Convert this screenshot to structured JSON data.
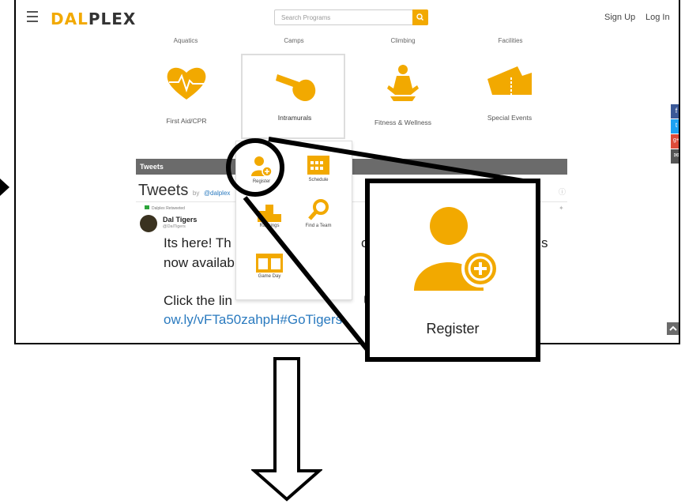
{
  "header": {
    "logo_part1": "DAL",
    "logo_part2": "PLEX",
    "search_placeholder": "Search Programs",
    "signup": "Sign Up",
    "login": "Log In"
  },
  "categories": [
    "Aquatics",
    "Camps",
    "Climbing",
    "Facilities"
  ],
  "tiles": [
    {
      "label": "First Aid/CPR"
    },
    {
      "label": "Intramurals"
    },
    {
      "label": "Fitness & Wellness"
    },
    {
      "label": "Special Events"
    }
  ],
  "dropdown": {
    "register": "Register",
    "schedule": "Schedule",
    "rankings": "Rankings",
    "find_team": "Find a Team",
    "game_day": "Game Day"
  },
  "tweets": {
    "bar_title": "Tweets",
    "heading": "Tweets",
    "by": "by",
    "handle": "@dalplex",
    "retweeted": "Dalplex Retweeted",
    "author": "Dal Tigers",
    "author_handle": "@DalTigers",
    "line1": "Its here! Th",
    "line1b": "of t",
    "line1c": "s",
    "line2": "now availab",
    "line3a": "Click the lin",
    "line3b": "Ur",
    "link": "ow.ly/vFTa50zahpH#GoTigers"
  },
  "zoom": {
    "label": "Register"
  },
  "colors": {
    "brand": "#f2a900",
    "dark": "#333333",
    "tweetbar": "#6b6b6b"
  }
}
